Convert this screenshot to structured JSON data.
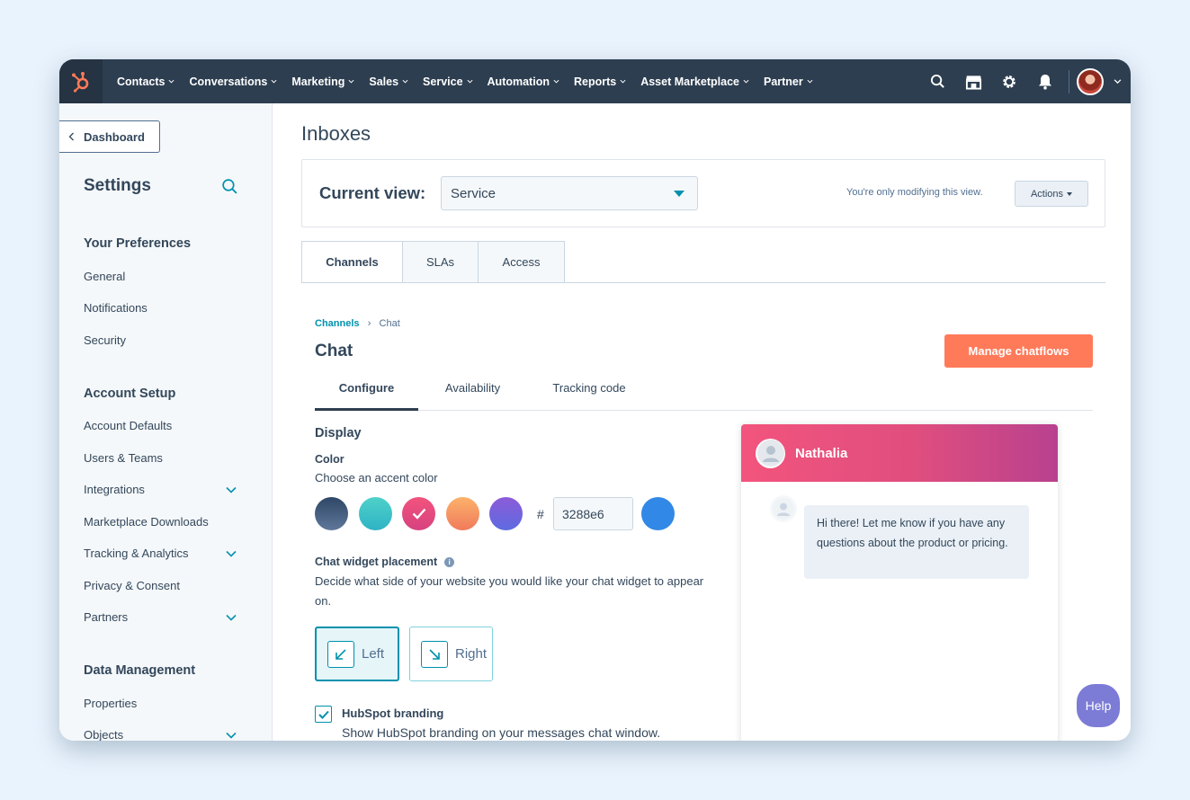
{
  "topnav": {
    "items": [
      "Contacts",
      "Conversations",
      "Marketing",
      "Sales",
      "Service",
      "Automation",
      "Reports",
      "Asset Marketplace",
      "Partner"
    ],
    "icons": [
      "search-icon",
      "marketplace-icon",
      "gear-icon",
      "bell-icon"
    ]
  },
  "sidebar": {
    "back_label": "Dashboard",
    "title": "Settings",
    "sections": [
      {
        "title": "Your Preferences",
        "items": [
          "General",
          "Notifications",
          "Security"
        ]
      },
      {
        "title": "Account Setup",
        "items": [
          "Account Defaults",
          "Users & Teams",
          "Integrations",
          "Marketplace Downloads",
          "Tracking & Analytics",
          "Privacy & Consent",
          "Partners"
        ]
      },
      {
        "title": "Data Management",
        "items": [
          "Properties",
          "Objects"
        ]
      }
    ]
  },
  "main": {
    "title": "Inboxes",
    "current_view_label": "Current view:",
    "current_view_value": "Service",
    "modify_note": "You're only modifying this view.",
    "actions_label": "Actions",
    "tabs": [
      "Channels",
      "SLAs",
      "Access"
    ],
    "breadcrumb": {
      "parent": "Channels",
      "current": "Chat"
    },
    "chat_title": "Chat",
    "manage_label": "Manage chatflows",
    "subtabs": [
      "Configure",
      "Availability",
      "Tracking code"
    ]
  },
  "display": {
    "heading": "Display",
    "color_label": "Color",
    "color_hint": "Choose an accent color",
    "swatches": [
      "#3f5575",
      "#3cc2c6",
      "#e84a7c",
      "#f99a56",
      "#7257d9"
    ],
    "hash": "#",
    "hex_value": "3288e6",
    "hex_color": "#3288e6",
    "placement_label": "Chat widget placement",
    "placement_hint": "Decide what side of your website you would like your chat widget to appear on.",
    "placement_left": "Left",
    "placement_right": "Right",
    "branding_label": "HubSpot branding",
    "branding_hint": "Show HubSpot branding on your messages chat window."
  },
  "preview": {
    "name": "Nathalia",
    "message": "Hi there! Let me know if you have any questions about the product or pricing."
  },
  "help_label": "Help",
  "colors": {
    "nav": "#2d3e50",
    "accent": "#ff7a59",
    "teal": "#0091ae"
  }
}
